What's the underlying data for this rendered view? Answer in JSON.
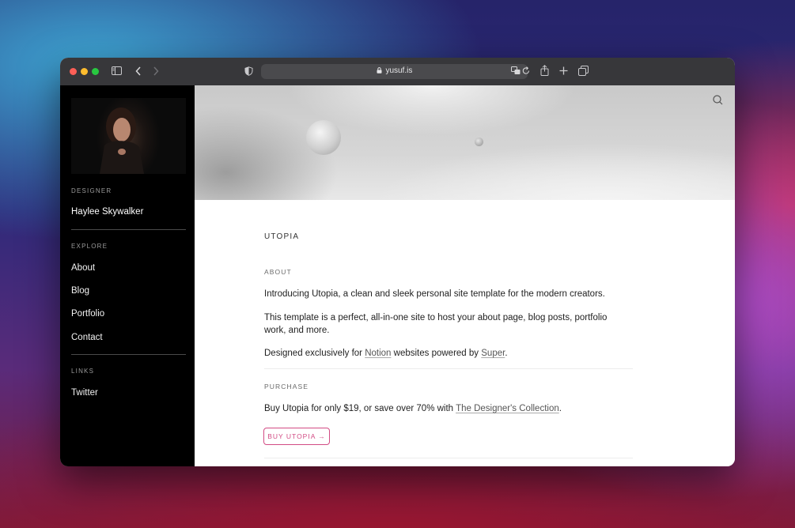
{
  "browser": {
    "url": "yusuf.is"
  },
  "sidebar": {
    "role_label": "DESIGNER",
    "name": "Haylee Skywalker",
    "explore_label": "EXPLORE",
    "explore_items": [
      {
        "label": "About"
      },
      {
        "label": "Blog"
      },
      {
        "label": "Portfolio"
      },
      {
        "label": "Contact"
      }
    ],
    "links_label": "LINKS",
    "links_items": [
      {
        "label": "Twitter"
      }
    ]
  },
  "main": {
    "title": "UTOPIA",
    "about": {
      "heading": "ABOUT",
      "para1": "Introducing Utopia, a clean and sleek personal site template for the modern creators.",
      "para2": "This template is a perfect, all-in-one site to host your about page, blog posts, portfolio work, and more.",
      "para3_prefix": "Designed exclusively for ",
      "para3_link1": "Notion",
      "para3_middle": " websites powered by ",
      "para3_link2": "Super",
      "para3_suffix": "."
    },
    "purchase": {
      "heading": "PURCHASE",
      "text_prefix": "Buy Utopia for only $19, or save over 70% with ",
      "text_link": "The Designer's Collection",
      "text_suffix": ".",
      "button_label": "BUY UTOPIA →"
    }
  },
  "colors": {
    "accent": "#d24b84",
    "sidebar_bg": "#000000",
    "toolbar_bg": "#37373a"
  },
  "icons": [
    "sidebar-toggle-icon",
    "back-icon",
    "forward-icon",
    "shield-icon",
    "lock-icon",
    "translate-icon",
    "reload-icon",
    "share-icon",
    "new-tab-icon",
    "tabs-overview-icon",
    "search-icon"
  ]
}
